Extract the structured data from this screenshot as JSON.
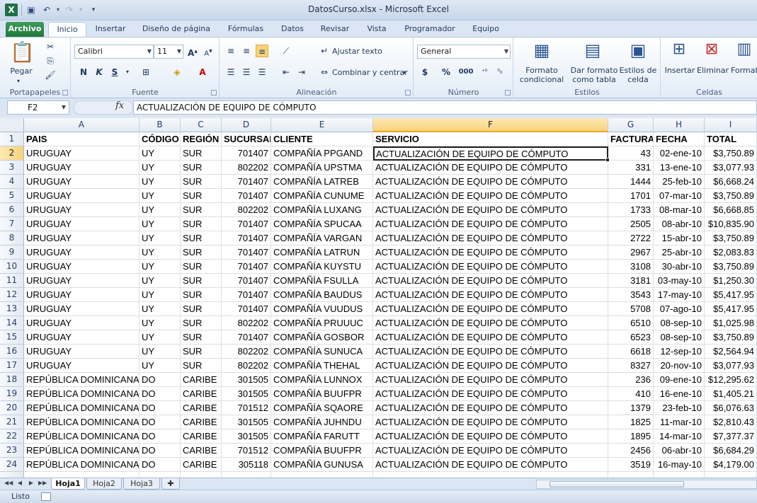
{
  "window": {
    "title": "DatosCurso.xlsx - Microsoft Excel"
  },
  "ribbon_tabs": [
    "Archivo",
    "Inicio",
    "Insertar",
    "Diseño de página",
    "Fórmulas",
    "Datos",
    "Revisar",
    "Vista",
    "Programador",
    "Equipo"
  ],
  "clipboard": {
    "paste": "Pegar",
    "label": "Portapapeles"
  },
  "font": {
    "name": "Calibri",
    "size": "11",
    "bold": "N",
    "italic": "K",
    "underline": "S",
    "label": "Fuente"
  },
  "alignment": {
    "wrap": "Ajustar texto",
    "merge": "Combinar y centrar",
    "label": "Alineación"
  },
  "number": {
    "format": "General",
    "currency": "$",
    "percent": "%",
    "thousands": "000",
    "label": "Número"
  },
  "styles": {
    "conditional": "Formato condicional",
    "table": "Dar formato como tabla",
    "cell": "Estilos de celda",
    "label": "Estilos"
  },
  "cells_group": {
    "insert": "Insertar",
    "delete": "Eliminar",
    "format": "Formato",
    "label": "Celdas"
  },
  "formula_bar": {
    "namebox": "F2",
    "fx": "fx",
    "value": "ACTUALIZACIÓN DE EQUIPO DE CÓMPUTO"
  },
  "columns": [
    "A",
    "B",
    "C",
    "D",
    "E",
    "F",
    "G",
    "H",
    "I"
  ],
  "headers": [
    "PAIS",
    "CÓDIGO",
    "REGIÓN",
    "SUCURSAL",
    "CLIENTE",
    "SERVICIO",
    "FACTURA",
    "FECHA",
    "TOTAL"
  ],
  "rows": [
    [
      "URUGUAY",
      "UY",
      "SUR",
      "701407",
      "COMPAÑÍA PPGAND",
      "ACTUALIZACIÓN DE EQUIPO DE CÓMPUTO",
      "43",
      "02-ene-10",
      "$3,750.89"
    ],
    [
      "URUGUAY",
      "UY",
      "SUR",
      "802202",
      "COMPAÑÍA UPSTMA",
      "ACTUALIZACIÓN DE EQUIPO DE CÓMPUTO",
      "331",
      "13-ene-10",
      "$3,077.93"
    ],
    [
      "URUGUAY",
      "UY",
      "SUR",
      "701407",
      "COMPAÑÍA LATREB",
      "ACTUALIZACIÓN DE EQUIPO DE CÓMPUTO",
      "1444",
      "25-feb-10",
      "$6,668.24"
    ],
    [
      "URUGUAY",
      "UY",
      "SUR",
      "701407",
      "COMPAÑÍA CUNUME",
      "ACTUALIZACIÓN DE EQUIPO DE CÓMPUTO",
      "1701",
      "07-mar-10",
      "$3,750.89"
    ],
    [
      "URUGUAY",
      "UY",
      "SUR",
      "802202",
      "COMPAÑÍA LUXANG",
      "ACTUALIZACIÓN DE EQUIPO DE CÓMPUTO",
      "1733",
      "08-mar-10",
      "$6,668.85"
    ],
    [
      "URUGUAY",
      "UY",
      "SUR",
      "701407",
      "COMPAÑÍA SPUCAA",
      "ACTUALIZACIÓN DE EQUIPO DE CÓMPUTO",
      "2505",
      "08-abr-10",
      "$10,835.90"
    ],
    [
      "URUGUAY",
      "UY",
      "SUR",
      "701407",
      "COMPAÑÍA VARGAN",
      "ACTUALIZACIÓN DE EQUIPO DE CÓMPUTO",
      "2722",
      "15-abr-10",
      "$3,750.89"
    ],
    [
      "URUGUAY",
      "UY",
      "SUR",
      "701407",
      "COMPAÑÍA LATRUN",
      "ACTUALIZACIÓN DE EQUIPO DE CÓMPUTO",
      "2967",
      "25-abr-10",
      "$2,083.83"
    ],
    [
      "URUGUAY",
      "UY",
      "SUR",
      "701407",
      "COMPAÑÍA KUYSTU",
      "ACTUALIZACIÓN DE EQUIPO DE CÓMPUTO",
      "3108",
      "30-abr-10",
      "$3,750.89"
    ],
    [
      "URUGUAY",
      "UY",
      "SUR",
      "701407",
      "COMPAÑÍA FSULLA",
      "ACTUALIZACIÓN DE EQUIPO DE CÓMPUTO",
      "3181",
      "03-may-10",
      "$1,250.30"
    ],
    [
      "URUGUAY",
      "UY",
      "SUR",
      "701407",
      "COMPAÑÍA BAUDUS",
      "ACTUALIZACIÓN DE EQUIPO DE CÓMPUTO",
      "3543",
      "17-may-10",
      "$5,417.95"
    ],
    [
      "URUGUAY",
      "UY",
      "SUR",
      "701407",
      "COMPAÑÍA VUUDUS",
      "ACTUALIZACIÓN DE EQUIPO DE CÓMPUTO",
      "5708",
      "07-ago-10",
      "$5,417.95"
    ],
    [
      "URUGUAY",
      "UY",
      "SUR",
      "802202",
      "COMPAÑÍA PRUUUC",
      "ACTUALIZACIÓN DE EQUIPO DE CÓMPUTO",
      "6510",
      "08-sep-10",
      "$1,025.98"
    ],
    [
      "URUGUAY",
      "UY",
      "SUR",
      "701407",
      "COMPAÑÍA GOSBOR",
      "ACTUALIZACIÓN DE EQUIPO DE CÓMPUTO",
      "6523",
      "08-sep-10",
      "$3,750.89"
    ],
    [
      "URUGUAY",
      "UY",
      "SUR",
      "802202",
      "COMPAÑÍA SUNUCA",
      "ACTUALIZACIÓN DE EQUIPO DE CÓMPUTO",
      "6618",
      "12-sep-10",
      "$2,564.94"
    ],
    [
      "URUGUAY",
      "UY",
      "SUR",
      "802202",
      "COMPAÑÍA THEHAL",
      "ACTUALIZACIÓN DE EQUIPO DE CÓMPUTO",
      "8327",
      "20-nov-10",
      "$3,077.93"
    ],
    [
      "REPÚBLICA DOMINICANA",
      "DO",
      "CARIBE",
      "301505",
      "COMPAÑÍA LUNNOX",
      "ACTUALIZACIÓN DE EQUIPO DE CÓMPUTO",
      "236",
      "09-ene-10",
      "$12,295.62"
    ],
    [
      "REPÚBLICA DOMINICANA",
      "DO",
      "CARIBE",
      "301505",
      "COMPAÑÍA BUUFPR",
      "ACTUALIZACIÓN DE EQUIPO DE CÓMPUTO",
      "410",
      "16-ene-10",
      "$1,405.21"
    ],
    [
      "REPÚBLICA DOMINICANA",
      "DO",
      "CARIBE",
      "701512",
      "COMPAÑÍA SQAORE",
      "ACTUALIZACIÓN DE EQUIPO DE CÓMPUTO",
      "1379",
      "23-feb-10",
      "$6,076.63"
    ],
    [
      "REPÚBLICA DOMINICANA",
      "DO",
      "CARIBE",
      "301505",
      "COMPAÑÍA JUHNDU",
      "ACTUALIZACIÓN DE EQUIPO DE CÓMPUTO",
      "1825",
      "11-mar-10",
      "$2,810.43"
    ],
    [
      "REPÚBLICA DOMINICANA",
      "DO",
      "CARIBE",
      "301505",
      "COMPAÑÍA FARUTT",
      "ACTUALIZACIÓN DE EQUIPO DE CÓMPUTO",
      "1895",
      "14-mar-10",
      "$7,377.37"
    ],
    [
      "REPÚBLICA DOMINICANA",
      "DO",
      "CARIBE",
      "701512",
      "COMPAÑÍA BUUFPR",
      "ACTUALIZACIÓN DE EQUIPO DE CÓMPUTO",
      "2456",
      "06-abr-10",
      "$6,684.29"
    ],
    [
      "REPÚBLICA DOMINICANA",
      "DO",
      "CARIBE",
      "305118",
      "COMPAÑÍA GUNUSA",
      "ACTUALIZACIÓN DE EQUIPO DE CÓMPUTO",
      "3519",
      "16-may-10",
      "$4,179.00"
    ]
  ],
  "sheets": [
    "Hoja1",
    "Hoja2",
    "Hoja3"
  ],
  "status": {
    "ready": "Listo"
  }
}
